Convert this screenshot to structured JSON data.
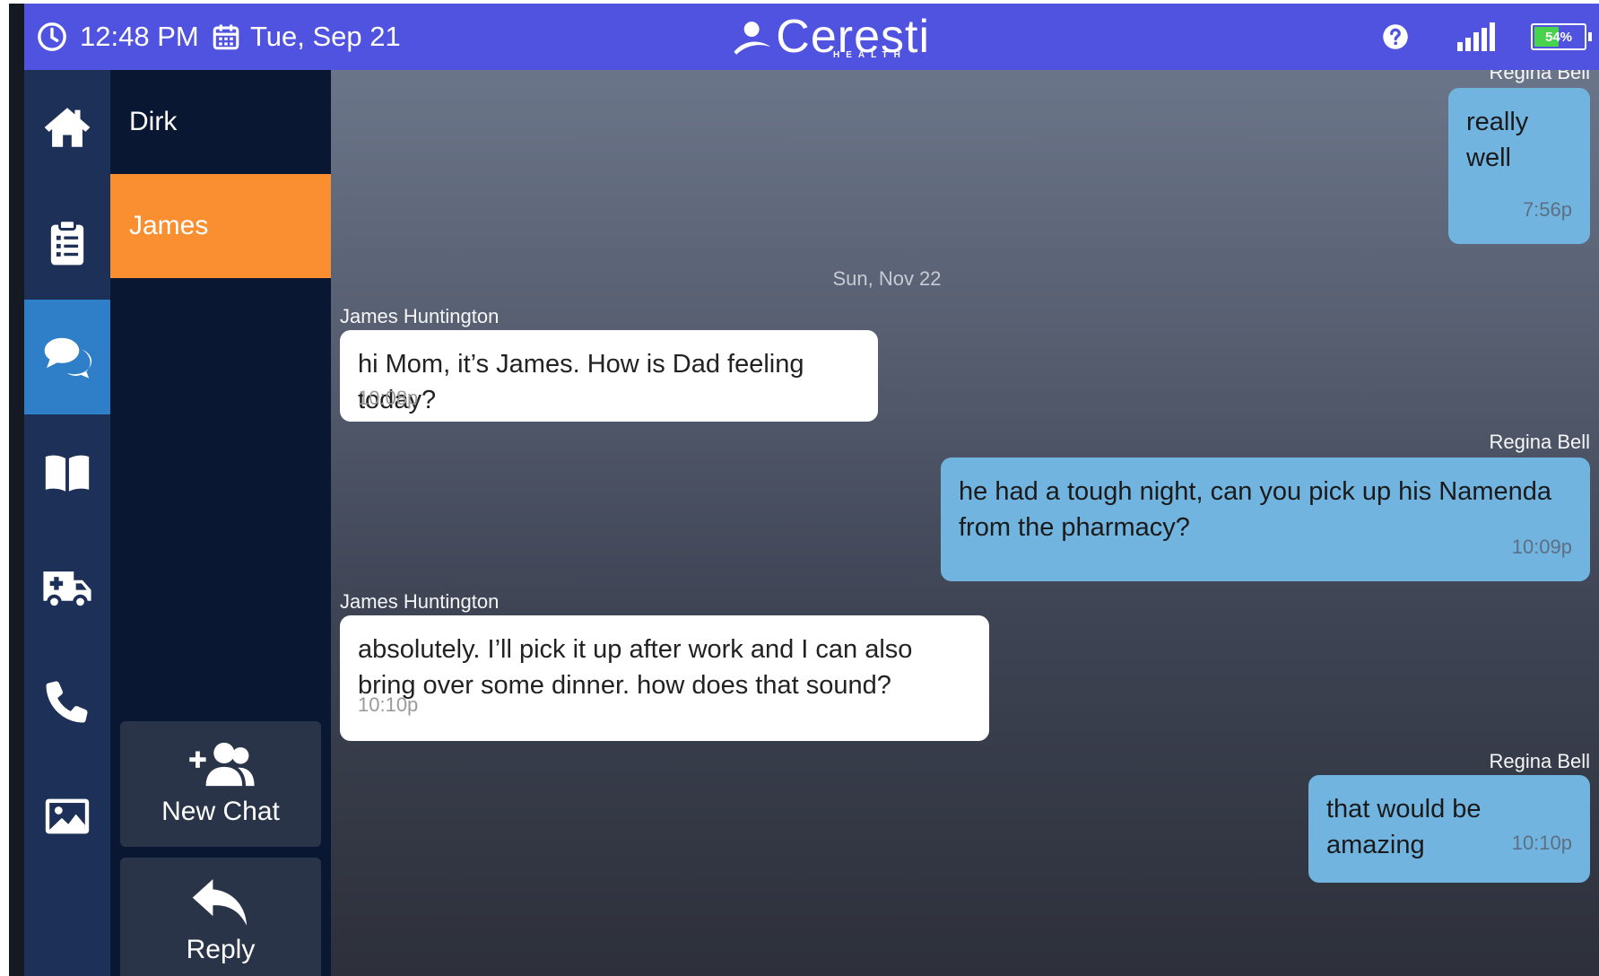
{
  "status_bar": {
    "time": "12:48 PM",
    "date": "Tue, Sep 21",
    "clock_icon": "clock-icon",
    "calendar_icon": "calendar-icon",
    "help_icon": "help-icon",
    "signal_icon": "signal-icon",
    "battery_percent": "54%",
    "battery_level": 0.54,
    "battery_color": "#49d24b"
  },
  "logo": {
    "name": "Ceresti",
    "subtitle": "HEALTH"
  },
  "nav_rail": {
    "items": [
      {
        "icon": "home-icon",
        "active": false
      },
      {
        "icon": "clipboard-icon",
        "active": false
      },
      {
        "icon": "chat-bubbles-icon",
        "active": true
      },
      {
        "icon": "book-icon",
        "active": false
      },
      {
        "icon": "ambulance-icon",
        "active": false
      },
      {
        "icon": "phone-icon",
        "active": false
      },
      {
        "icon": "image-icon",
        "active": false
      }
    ],
    "active_color": "#2f7ec8"
  },
  "chat_list": {
    "chats": [
      {
        "name": "Dirk",
        "active": false
      },
      {
        "name": "James",
        "active": true
      }
    ],
    "active_color": "#fa8f32",
    "new_chat_label": "New Chat",
    "new_chat_icon": "add-group-icon",
    "reply_label": "Reply",
    "reply_icon": "reply-arrow-icon"
  },
  "conversation": {
    "messages": [
      {
        "sender": "Regina Bell",
        "text": "really well",
        "time": "7:56p",
        "side": "right"
      },
      {
        "divider": "Sun, Nov 22"
      },
      {
        "sender": "James Huntington",
        "text": "hi Mom, it’s James.  How is Dad feeling today?",
        "time": "10:08p",
        "side": "left"
      },
      {
        "sender": "Regina Bell",
        "text": "he had a tough night, can you pick up his Namenda from the pharmacy?",
        "time": "10:09p",
        "side": "right"
      },
      {
        "sender": "James Huntington",
        "text": "absolutely.  I’ll pick it up after work and I can also bring over some dinner.  how does that sound?",
        "time": "10:10p",
        "side": "left"
      },
      {
        "sender": "Regina Bell",
        "text": "that would be amazing",
        "time": "10:10p",
        "side": "right"
      }
    ],
    "my_bubble_color": "#71b4e0",
    "their_bubble_color": "#ffffff"
  }
}
